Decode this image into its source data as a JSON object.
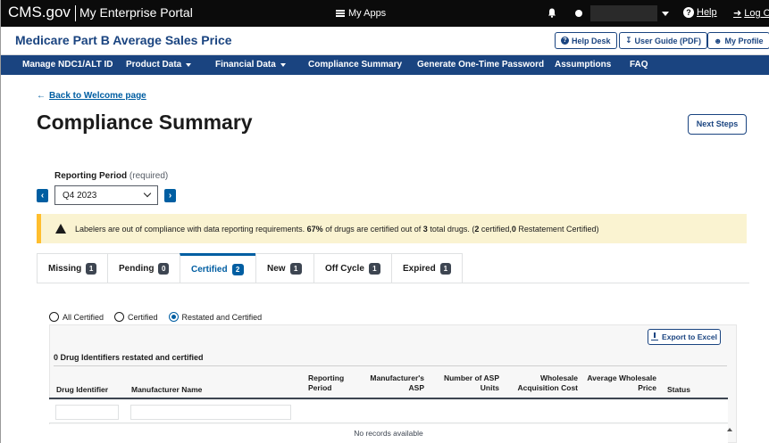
{
  "topbar": {
    "brand": "CMS.gov",
    "portal": "My Enterprise Portal",
    "my_apps": "My Apps",
    "help": "Help",
    "logout": "Log Out"
  },
  "header": {
    "app_title": "Medicare Part B Average Sales Price",
    "help_desk": "Help Desk",
    "user_guide": "User Guide (PDF)",
    "my_profile": "My Profile"
  },
  "nav": {
    "items": [
      {
        "label": "Manage NDC1/ALT ID"
      },
      {
        "label": "Product Data"
      },
      {
        "label": "Financial Data"
      },
      {
        "label": "Compliance Summary"
      },
      {
        "label": "Generate One-Time Password"
      },
      {
        "label": "Assumptions"
      },
      {
        "label": "FAQ"
      }
    ]
  },
  "page": {
    "back_link": "Back to Welcome page",
    "title": "Compliance Summary",
    "next_steps": "Next Steps"
  },
  "reporting_period": {
    "label": "Reporting Period",
    "required": "(required)",
    "value": "Q4 2023"
  },
  "alert": {
    "text_1": "Labelers are out of compliance with data reporting requirements.",
    "pct": "67%",
    "text_2": "of drugs are certified out of",
    "total": "3",
    "text_3": "total drugs. (",
    "certified": "2",
    "text_4": "certified,",
    "restated": "0",
    "text_5": "Restatement Certified)"
  },
  "tabs": [
    {
      "label": "Missing",
      "count": "1"
    },
    {
      "label": "Pending",
      "count": "0"
    },
    {
      "label": "Certified",
      "count": "2"
    },
    {
      "label": "New",
      "count": "1"
    },
    {
      "label": "Off Cycle",
      "count": "1"
    },
    {
      "label": "Expired",
      "count": "1"
    }
  ],
  "radios": {
    "all": "All Certified",
    "certified": "Certified",
    "restated": "Restated and Certified",
    "selected": "Restated and Certified"
  },
  "table": {
    "export": "Export to Excel",
    "summary": "0 Drug Identifiers restated and certified",
    "columns": {
      "drug_id": "Drug Identifier",
      "mfr_name": "Manufacturer Name",
      "rp_1": "Reporting",
      "rp_2": "Period",
      "masp_1": "Manufacturer's",
      "masp_2": "ASP",
      "units_1": "Number of ASP",
      "units_2": "Units",
      "wac_1": "Wholesale",
      "wac_2": "Acquisition Cost",
      "awp_1": "Average Wholesale",
      "awp_2": "Price",
      "status": "Status"
    },
    "no_records": "No records available"
  },
  "colors": {
    "navy": "#1a4480",
    "primary": "#005ea2",
    "warning_bg": "#faf3d1",
    "warning_border": "#ffbe2e"
  }
}
